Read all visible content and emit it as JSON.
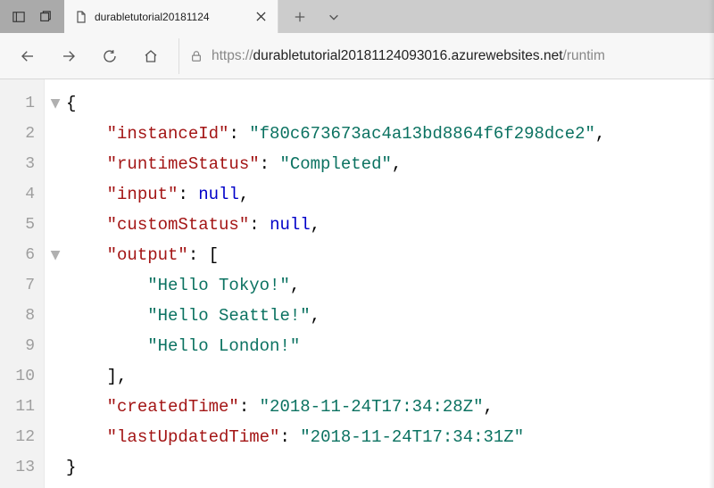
{
  "window": {
    "tabTitle": "durabletutorial20181124",
    "url_scheme": "https://",
    "url_host": "durabletutorial20181124093016.azurewebsites.net",
    "url_rest": "/runtim"
  },
  "code": {
    "lineNumbers": [
      "1",
      "2",
      "3",
      "4",
      "5",
      "6",
      "7",
      "8",
      "9",
      "10",
      "11",
      "12",
      "13"
    ],
    "foldMarkers": [
      "▼",
      "",
      "",
      "",
      "",
      "▼",
      "",
      "",
      "",
      "",
      "",
      "",
      ""
    ],
    "lines": [
      {
        "indent": 0,
        "parts": [
          {
            "t": "p",
            "v": "{"
          }
        ]
      },
      {
        "indent": 1,
        "parts": [
          {
            "t": "key",
            "v": "\"instanceId\""
          },
          {
            "t": "p",
            "v": ": "
          },
          {
            "t": "str",
            "v": "\"f80c673673ac4a13bd8864f6f298dce2\""
          },
          {
            "t": "p",
            "v": ","
          }
        ]
      },
      {
        "indent": 1,
        "parts": [
          {
            "t": "key",
            "v": "\"runtimeStatus\""
          },
          {
            "t": "p",
            "v": ": "
          },
          {
            "t": "str",
            "v": "\"Completed\""
          },
          {
            "t": "p",
            "v": ","
          }
        ]
      },
      {
        "indent": 1,
        "parts": [
          {
            "t": "key",
            "v": "\"input\""
          },
          {
            "t": "p",
            "v": ": "
          },
          {
            "t": "null",
            "v": "null"
          },
          {
            "t": "p",
            "v": ","
          }
        ]
      },
      {
        "indent": 1,
        "parts": [
          {
            "t": "key",
            "v": "\"customStatus\""
          },
          {
            "t": "p",
            "v": ": "
          },
          {
            "t": "null",
            "v": "null"
          },
          {
            "t": "p",
            "v": ","
          }
        ]
      },
      {
        "indent": 1,
        "parts": [
          {
            "t": "key",
            "v": "\"output\""
          },
          {
            "t": "p",
            "v": ": ["
          }
        ]
      },
      {
        "indent": 2,
        "parts": [
          {
            "t": "str",
            "v": "\"Hello Tokyo!\""
          },
          {
            "t": "p",
            "v": ","
          }
        ]
      },
      {
        "indent": 2,
        "parts": [
          {
            "t": "str",
            "v": "\"Hello Seattle!\""
          },
          {
            "t": "p",
            "v": ","
          }
        ]
      },
      {
        "indent": 2,
        "parts": [
          {
            "t": "str",
            "v": "\"Hello London!\""
          }
        ]
      },
      {
        "indent": 1,
        "parts": [
          {
            "t": "p",
            "v": "],"
          }
        ]
      },
      {
        "indent": 1,
        "parts": [
          {
            "t": "key",
            "v": "\"createdTime\""
          },
          {
            "t": "p",
            "v": ": "
          },
          {
            "t": "str",
            "v": "\"2018-11-24T17:34:28Z\""
          },
          {
            "t": "p",
            "v": ","
          }
        ]
      },
      {
        "indent": 1,
        "parts": [
          {
            "t": "key",
            "v": "\"lastUpdatedTime\""
          },
          {
            "t": "p",
            "v": ": "
          },
          {
            "t": "str",
            "v": "\"2018-11-24T17:34:31Z\""
          }
        ]
      },
      {
        "indent": 0,
        "parts": [
          {
            "t": "p",
            "v": "}"
          }
        ]
      }
    ]
  }
}
